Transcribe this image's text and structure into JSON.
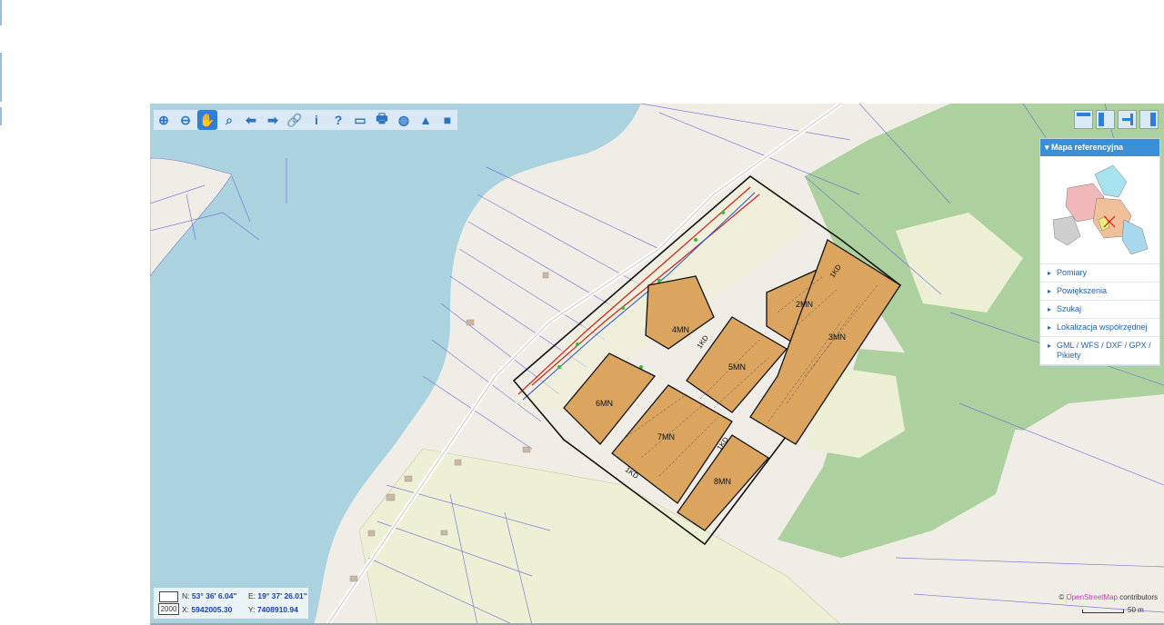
{
  "toolbar": {
    "tools": [
      {
        "icon": "zoom-in-icon",
        "glyph": "⊕"
      },
      {
        "icon": "zoom-out-icon",
        "glyph": "⊖"
      },
      {
        "icon": "pan-hand-icon",
        "glyph": "✋"
      },
      {
        "icon": "zoom-extent-icon",
        "glyph": "⌕"
      },
      {
        "icon": "back-arrow-icon",
        "glyph": "⬅"
      },
      {
        "icon": "forward-arrow-icon",
        "glyph": "➡"
      },
      {
        "icon": "link-icon",
        "glyph": "🔗"
      },
      {
        "icon": "info-icon",
        "glyph": "i"
      },
      {
        "icon": "query-icon",
        "glyph": "?"
      },
      {
        "icon": "measure-icon",
        "glyph": "▭"
      },
      {
        "icon": "print-icon",
        "glyph": "🖶"
      },
      {
        "icon": "globe-icon",
        "glyph": "◍"
      },
      {
        "icon": "warning-icon",
        "glyph": "▲"
      },
      {
        "icon": "video-icon",
        "glyph": "■"
      }
    ],
    "active_tool": "pan-hand-icon"
  },
  "view_buttons": [
    "layout-top-icon",
    "layout-left-icon",
    "layout-exit-icon",
    "layout-right-icon"
  ],
  "panel": {
    "header": "Mapa referencyjna",
    "items": [
      "Pomiary",
      "Powiększenia",
      "Szukaj",
      "Lokalizacja współrzędnej",
      "GML / WFS / DXF / GPX / Pikiety"
    ]
  },
  "coords": {
    "n_label": "N:",
    "n_value": "53° 36' 6.04\"",
    "e_label": "E:",
    "e_value": "19° 37' 26.01\"",
    "scale": "2000",
    "x_label": "X:",
    "x_value": "5942005.30",
    "y_label": "Y:",
    "y_value": "7408910.94"
  },
  "attribution": {
    "prefix": "©",
    "link": "OpenStreetMap",
    "suffix": "contributors"
  },
  "scale_bar": "50 m",
  "parcels": [
    "2MN",
    "3MN",
    "4MN",
    "5MN",
    "6MN",
    "7MN",
    "8MN"
  ],
  "road_labels": [
    "1KD",
    "1KD",
    "1KD",
    "1KD"
  ],
  "colors": {
    "water": "#aad3df",
    "forest": "#add19e",
    "land": "#f0ede6",
    "farmland": "#eef0d5",
    "parcel_fill": "#dba45f",
    "accent": "#3a8fd6"
  }
}
